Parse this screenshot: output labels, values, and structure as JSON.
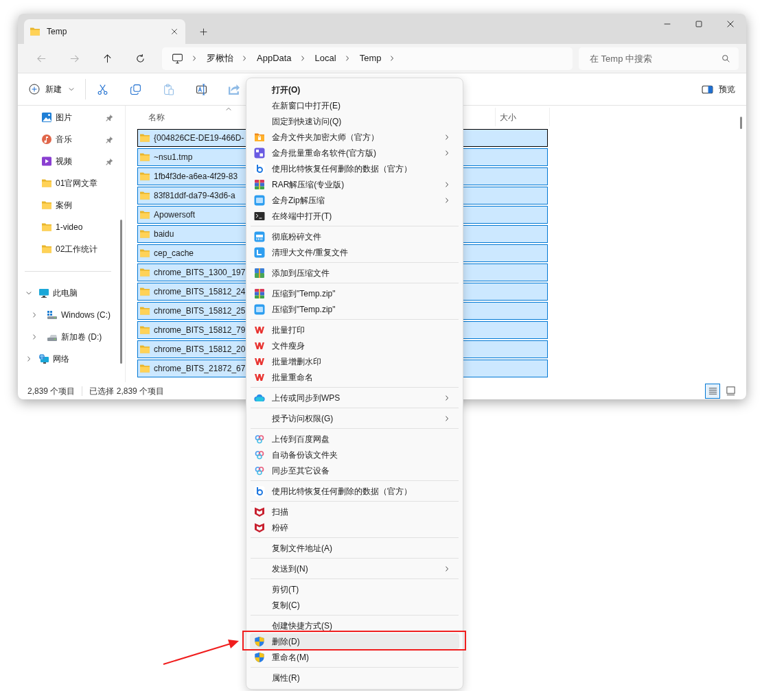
{
  "window": {
    "tabs": [
      {
        "label": "Temp",
        "selected": true
      }
    ]
  },
  "nav_buttons": [
    {
      "kind": "back",
      "disabled": true
    },
    {
      "kind": "forward",
      "disabled": true
    },
    {
      "kind": "up",
      "disabled": false
    },
    {
      "kind": "refresh",
      "disabled": false
    }
  ],
  "address": {
    "crumbs": [
      "罗楸怡",
      "AppData",
      "Local",
      "Temp"
    ]
  },
  "search": {
    "placeholder": "在 Temp 中搜索"
  },
  "toolbar": {
    "new_label": "新建",
    "tools": [
      {
        "kind": "cut",
        "disabled": false
      },
      {
        "kind": "copy",
        "disabled": false
      },
      {
        "kind": "paste",
        "disabled": true
      },
      {
        "kind": "rename",
        "disabled": false
      },
      {
        "kind": "share",
        "disabled": true
      }
    ],
    "preview_label": "预览"
  },
  "sidebar": {
    "quick_access": [
      {
        "label": "图片",
        "kind": "pictures",
        "pinned": true
      },
      {
        "label": "音乐",
        "kind": "music",
        "pinned": true
      },
      {
        "label": "视频",
        "kind": "video",
        "pinned": true
      },
      {
        "label": "01官网文章",
        "kind": "folder",
        "pinned": false
      },
      {
        "label": "案例",
        "kind": "folder",
        "pinned": false
      },
      {
        "label": "1-video",
        "kind": "folder",
        "pinned": false
      },
      {
        "label": "02工作统计",
        "kind": "folder",
        "pinned": false
      }
    ],
    "tree": [
      {
        "label": "此电脑",
        "kind": "pc",
        "expanded": true,
        "children": [
          {
            "label": "Windows (C:)",
            "kind": "drive-c",
            "expanded": false
          },
          {
            "label": "新加卷 (D:)",
            "kind": "drive",
            "expanded": false
          }
        ]
      },
      {
        "label": "网络",
        "kind": "network",
        "expanded": false
      }
    ]
  },
  "file_list": {
    "columns": [
      "名称",
      "大小"
    ],
    "sort_ascending": true,
    "rows": [
      {
        "name": "{004826CE-DE19-466D-",
        "selected": true,
        "focused": true
      },
      {
        "name": "~nsu1.tmp",
        "selected": true,
        "focused": false
      },
      {
        "name": "1fb4f3de-a6ea-4f29-83",
        "selected": true,
        "focused": false
      },
      {
        "name": "83f81ddf-da79-43d6-a",
        "selected": true,
        "focused": false
      },
      {
        "name": "Apowersoft",
        "selected": true,
        "focused": false
      },
      {
        "name": "baidu",
        "selected": true,
        "focused": false
      },
      {
        "name": "cep_cache",
        "selected": true,
        "focused": false
      },
      {
        "name": "chrome_BITS_1300_197",
        "selected": true,
        "focused": false
      },
      {
        "name": "chrome_BITS_15812_24",
        "selected": true,
        "focused": false
      },
      {
        "name": "chrome_BITS_15812_25",
        "selected": true,
        "focused": false
      },
      {
        "name": "chrome_BITS_15812_79",
        "selected": true,
        "focused": false
      },
      {
        "name": "chrome_BITS_15812_20",
        "selected": true,
        "focused": false
      },
      {
        "name": "chrome_BITS_21872_67",
        "selected": true,
        "focused": false
      }
    ]
  },
  "status_bar": {
    "count": "2,839 个项目",
    "selection": "已选择 2,839 个项目",
    "views": [
      {
        "kind": "details",
        "selected": true
      },
      {
        "kind": "tiles",
        "selected": false
      }
    ]
  },
  "context_menu": {
    "groups": [
      [
        {
          "label": "打开(O)",
          "kind": "default",
          "submenu": false,
          "selected": false
        },
        {
          "label": "在新窗口中打开(E)",
          "kind": "plain",
          "submenu": false,
          "selected": false
        },
        {
          "label": "固定到快速访问(Q)",
          "kind": "plain",
          "submenu": false,
          "selected": false
        },
        {
          "label": "金舟文件夹加密大师（官方）",
          "kind": "folder-lock",
          "submenu": true,
          "selected": false
        },
        {
          "label": "金舟批量重命名软件(官方版)",
          "kind": "rename-app",
          "submenu": true,
          "selected": false
        },
        {
          "label": "使用比特恢复任何删除的数据（官方）",
          "kind": "recover",
          "submenu": false,
          "selected": false
        },
        {
          "label": "RAR解压缩(专业版)",
          "kind": "rar",
          "submenu": true,
          "selected": false
        },
        {
          "label": "金舟Zip解压缩",
          "kind": "zip",
          "submenu": true,
          "selected": false
        },
        {
          "label": "在终端中打开(T)",
          "kind": "terminal",
          "submenu": false,
          "selected": false
        }
      ],
      [
        {
          "label": "彻底粉碎文件",
          "kind": "shredder",
          "submenu": false,
          "selected": false
        },
        {
          "label": "清理大文件/重复文件",
          "kind": "cleaner",
          "submenu": false,
          "selected": false
        }
      ],
      [
        {
          "label": "添加到压缩文件",
          "kind": "archive-add",
          "submenu": false,
          "selected": false
        }
      ],
      [
        {
          "label": "压缩到\"Temp.zip\"",
          "kind": "rar",
          "submenu": false,
          "selected": false
        },
        {
          "label": "压缩到\"Temp.zip\"",
          "kind": "zip",
          "submenu": false,
          "selected": false
        }
      ],
      [
        {
          "label": "批量打印",
          "kind": "wps",
          "submenu": false,
          "selected": false
        },
        {
          "label": "文件瘦身",
          "kind": "wps",
          "submenu": false,
          "selected": false
        },
        {
          "label": "批量增删水印",
          "kind": "wps",
          "submenu": false,
          "selected": false
        },
        {
          "label": "批量重命名",
          "kind": "wps",
          "submenu": false,
          "selected": false
        }
      ],
      [
        {
          "label": "上传或同步到WPS",
          "kind": "cloud",
          "submenu": true,
          "selected": false
        }
      ],
      [
        {
          "label": "授予访问权限(G)",
          "kind": "plain",
          "submenu": true,
          "selected": false
        }
      ],
      [
        {
          "label": "上传到百度网盘",
          "kind": "baidu",
          "submenu": false,
          "selected": false
        },
        {
          "label": "自动备份该文件夹",
          "kind": "baidu",
          "submenu": false,
          "selected": false
        },
        {
          "label": "同步至其它设备",
          "kind": "baidu",
          "submenu": false,
          "selected": false
        }
      ],
      [
        {
          "label": "使用比特恢复任何删除的数据（官方）",
          "kind": "recover",
          "submenu": false,
          "selected": false
        }
      ],
      [
        {
          "label": "扫描",
          "kind": "mcafee",
          "submenu": false,
          "selected": false
        },
        {
          "label": "粉碎",
          "kind": "mcafee",
          "submenu": false,
          "selected": false
        }
      ],
      [
        {
          "label": "复制文件地址(A)",
          "kind": "plain",
          "submenu": false,
          "selected": false
        }
      ],
      [
        {
          "label": "发送到(N)",
          "kind": "plain",
          "submenu": true,
          "selected": false
        }
      ],
      [
        {
          "label": "剪切(T)",
          "kind": "plain",
          "submenu": false,
          "selected": false
        },
        {
          "label": "复制(C)",
          "kind": "plain",
          "submenu": false,
          "selected": false
        }
      ],
      [
        {
          "label": "创建快捷方式(S)",
          "kind": "plain",
          "submenu": false,
          "selected": false
        },
        {
          "label": "删除(D)",
          "kind": "shield",
          "submenu": false,
          "selected": true
        },
        {
          "label": "重命名(M)",
          "kind": "shield",
          "submenu": false,
          "selected": false
        }
      ],
      [
        {
          "label": "属性(R)",
          "kind": "plain",
          "submenu": false,
          "selected": false
        }
      ]
    ]
  }
}
